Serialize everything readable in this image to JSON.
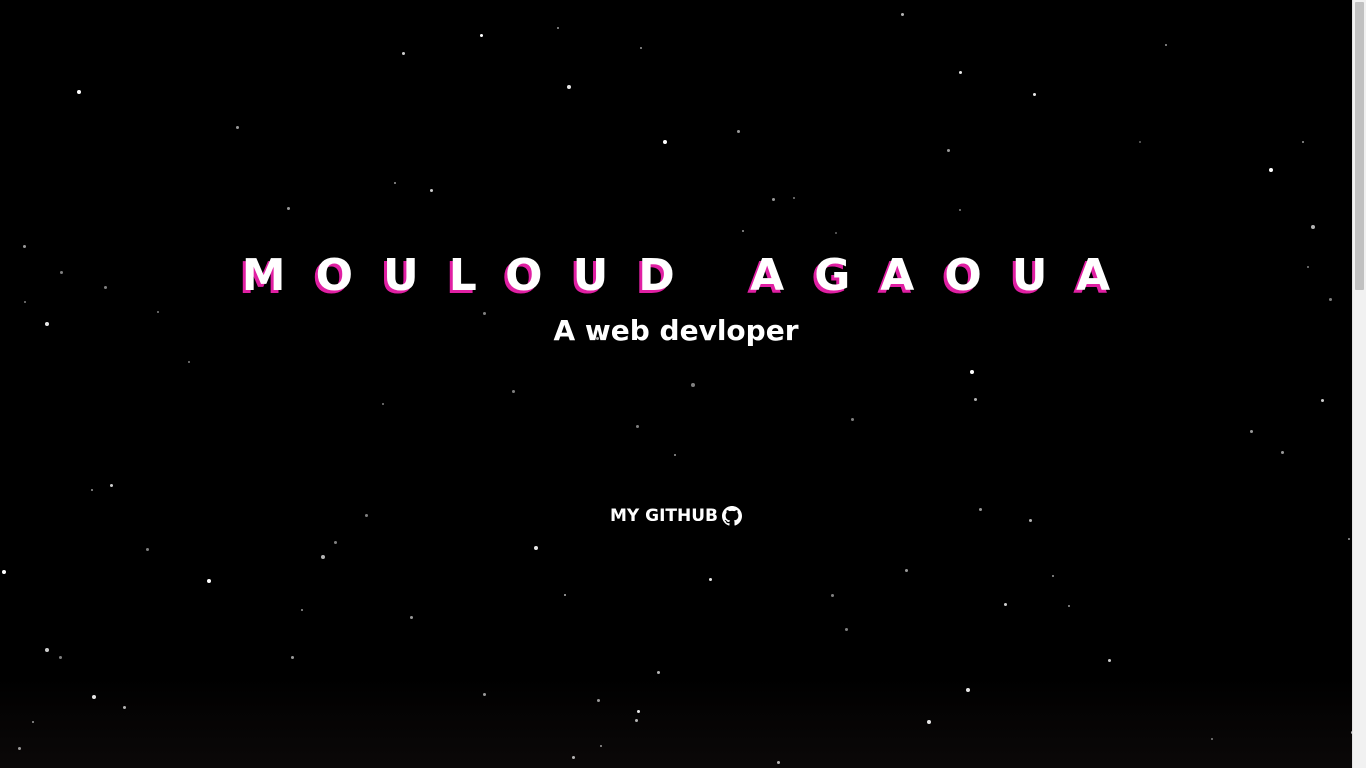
{
  "hero": {
    "title": "MOULOUD AGAOUA",
    "subtitle": "A web devloper"
  },
  "links": {
    "github_label": "MY GITHUB",
    "github_icon": "github-icon"
  },
  "colors": {
    "background": "#000000",
    "text": "#ffffff",
    "title_shadow": "#e01fa3"
  }
}
